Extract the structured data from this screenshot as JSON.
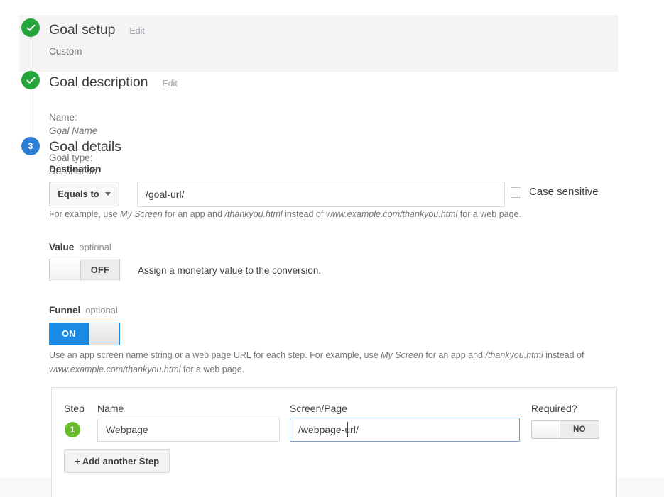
{
  "steps": [
    {
      "id": "goal-setup",
      "title": "Goal setup",
      "edit_label": "Edit",
      "summary": "Custom",
      "state": "complete"
    },
    {
      "id": "goal-description",
      "title": "Goal description",
      "edit_label": "Edit",
      "summary": "Name: Goal Name\nGoal type: Destination",
      "summary_label_1": "Name:",
      "summary_value_1": "Goal Name",
      "summary_label_2": "Goal type:",
      "summary_value_2": "Destination",
      "state": "complete"
    },
    {
      "id": "goal-details",
      "title": "Goal details",
      "number": "3",
      "state": "active"
    }
  ],
  "destination": {
    "label": "Destination",
    "match_type": "Equals to",
    "url_value": "/goal-url/",
    "case_sensitive_label": "Case sensitive",
    "case_sensitive_checked": false,
    "hint": {
      "part1": "For example, use ",
      "em1": "My Screen",
      "part2": " for an app and ",
      "em2": "/thankyou.html",
      "part3": " instead of ",
      "em3": "www.example.com/thankyou.html",
      "part4": " for a web page."
    }
  },
  "value": {
    "label": "Value",
    "optional_label": "optional",
    "toggle_state": "OFF",
    "description": "Assign a monetary value to the conversion."
  },
  "funnel": {
    "label": "Funnel",
    "optional_label": "optional",
    "toggle_state": "ON",
    "hint": {
      "part1": "Use an app screen name string or a web page URL for each step. For example, use ",
      "em1": "My Screen",
      "part2": " for an app and ",
      "em2": "/thankyou.html",
      "part3": " instead of ",
      "em3": "www.example.com/thankyou.html",
      "part4": " for a web page."
    },
    "columns": {
      "step": "Step",
      "name": "Name",
      "screen_page": "Screen/Page",
      "required": "Required?"
    },
    "rows": [
      {
        "number": "1",
        "name": "Webpage",
        "screen_page": "/webpage-url/",
        "required": "NO"
      }
    ],
    "add_step_label": "+ Add another Step"
  },
  "colors": {
    "complete_green": "#25a43c",
    "active_blue": "#2d7fd3",
    "toggle_on_blue": "#1a8ae5",
    "step_badge_green": "#66bb2a",
    "focus_border": "#6b9ae0"
  }
}
